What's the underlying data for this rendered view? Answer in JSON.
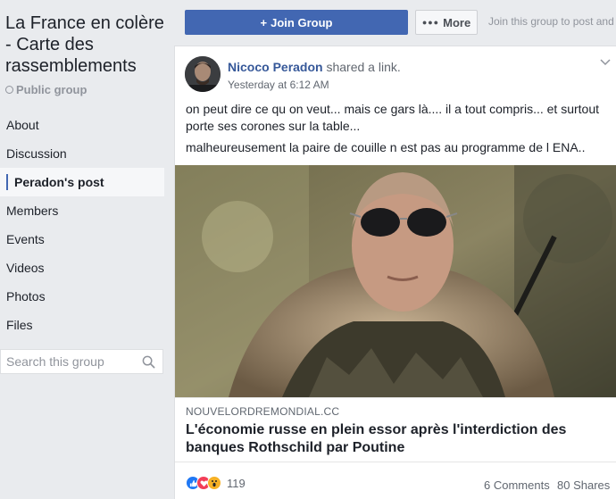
{
  "group": {
    "title": "La France en colère - Carte des rassemblements",
    "type_label": "Public group"
  },
  "nav": {
    "items": [
      {
        "label": "About"
      },
      {
        "label": "Discussion"
      },
      {
        "label": "Peradon's post"
      },
      {
        "label": "Members"
      },
      {
        "label": "Events"
      },
      {
        "label": "Videos"
      },
      {
        "label": "Photos"
      },
      {
        "label": "Files"
      }
    ],
    "active_index": 2
  },
  "search": {
    "placeholder": "Search this group"
  },
  "toolbar": {
    "join_label": "Join Group",
    "more_label": "More",
    "join_hint": "Join this group to post and"
  },
  "post": {
    "author": "Nicoco Peradon",
    "action": "shared a link.",
    "timestamp": "Yesterday at 6:12 AM",
    "text_1": "on peut dire ce qu on veut... mais ce gars là.... il a tout compris... et surtout porte ses corones sur la table...",
    "text_2": "malheureusement la paire de couille n est pas au programme de l ENA..",
    "link": {
      "domain": "NOUVELORDREMONDIAL.CC",
      "title": "L'économie russe en plein essor après l'interdiction des banques Rothschild par Poutine"
    },
    "reactions_count": "119",
    "comments_label": "6 Comments",
    "shares_label": "80 Shares"
  },
  "colors": {
    "brand": "#4267b2",
    "link": "#365899",
    "like": "#2078f4",
    "love": "#f33e58",
    "wow": "#f7b125"
  }
}
